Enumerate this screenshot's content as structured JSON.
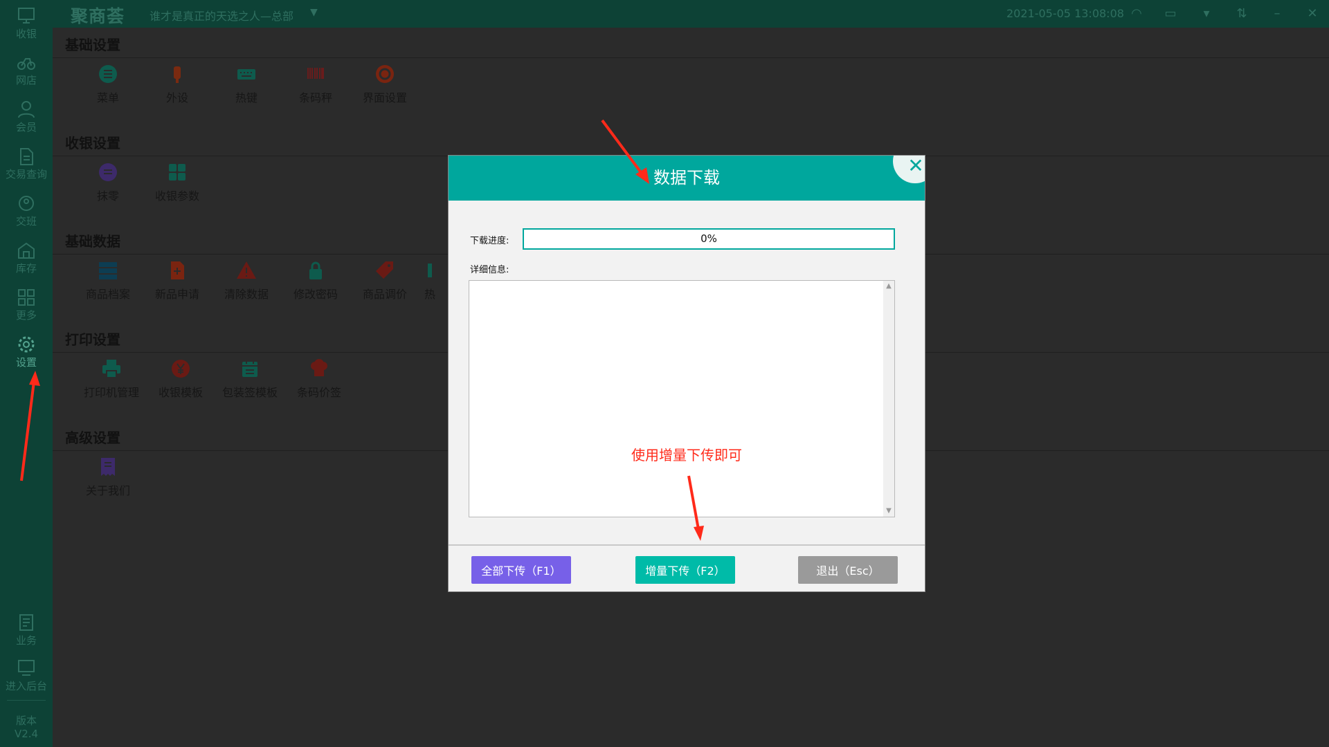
{
  "sidebar": {
    "items": [
      {
        "label": "收银",
        "icon": "monitor-icon"
      },
      {
        "label": "网店",
        "icon": "bike-icon"
      },
      {
        "label": "会员",
        "icon": "person-icon"
      },
      {
        "label": "交易查询",
        "icon": "document-icon"
      },
      {
        "label": "交班",
        "icon": "handover-icon"
      },
      {
        "label": "库存",
        "icon": "warehouse-icon"
      },
      {
        "label": "更多",
        "icon": "grid-icon"
      },
      {
        "label": "设置",
        "icon": "gear-icon"
      },
      {
        "label": "业务",
        "icon": "ledger-icon"
      },
      {
        "label": "进入后台",
        "icon": "screen-icon"
      }
    ],
    "active": "设置",
    "version_label": "版本",
    "version_value": "V2.4"
  },
  "topbar": {
    "brand": "聚商荟",
    "store_name": "谁才是真正的天选之人—总部",
    "datetime": "2021-05-05 13:08:08",
    "icons": [
      "wifi-icon",
      "message-icon",
      "shirt-icon",
      "swap-icon",
      "minimize-icon",
      "close-icon"
    ]
  },
  "sections": [
    {
      "title": "基础设置",
      "tiles": [
        {
          "label": "菜单",
          "icon": "menu-icon"
        },
        {
          "label": "外设",
          "icon": "peripheral-icon"
        },
        {
          "label": "热键",
          "icon": "keyboard-icon"
        },
        {
          "label": "条码秤",
          "icon": "barcode-icon"
        },
        {
          "label": "界面设置",
          "icon": "interface-icon"
        }
      ]
    },
    {
      "title": "收银设置",
      "tiles": [
        {
          "label": "抹零",
          "icon": "rounding-icon"
        },
        {
          "label": "收银参数",
          "icon": "parameters-icon"
        }
      ]
    },
    {
      "title": "基础数据",
      "tiles": [
        {
          "label": "商品档案",
          "icon": "product-archive-icon"
        },
        {
          "label": "新品申请",
          "icon": "new-product-icon"
        },
        {
          "label": "清除数据",
          "icon": "warning-icon"
        },
        {
          "label": "修改密码",
          "icon": "lock-icon"
        },
        {
          "label": "商品调价",
          "icon": "price-tag-icon"
        },
        {
          "label": "热",
          "icon": "hot-icon"
        }
      ]
    },
    {
      "title": "打印设置",
      "tiles": [
        {
          "label": "打印机管理",
          "icon": "printer-icon"
        },
        {
          "label": "收银模板",
          "icon": "yen-icon"
        },
        {
          "label": "包装签模板",
          "icon": "package-label-icon"
        },
        {
          "label": "条码价签",
          "icon": "chef-hat-icon"
        }
      ]
    },
    {
      "title": "高级设置",
      "tiles": [
        {
          "label": "关于我们",
          "icon": "receipt-icon"
        }
      ]
    }
  ],
  "dialog": {
    "title": "数据下载",
    "progress_label": "下载进度:",
    "progress_value": 0,
    "progress_text": "0%",
    "detail_label": "详细信息:",
    "detail_text": "",
    "annotation": "使用增量下传即可",
    "buttons": {
      "all": "全部下传（F1）",
      "incremental": "增量下传（F2）",
      "exit": "退出（Esc）"
    }
  },
  "colors": {
    "teal": "#00a79d",
    "sidebar_bg": "#0d4236",
    "annotation_red": "#ff2a1a",
    "btn_purple": "#7760e8",
    "btn_grey": "#9a9a9a"
  }
}
